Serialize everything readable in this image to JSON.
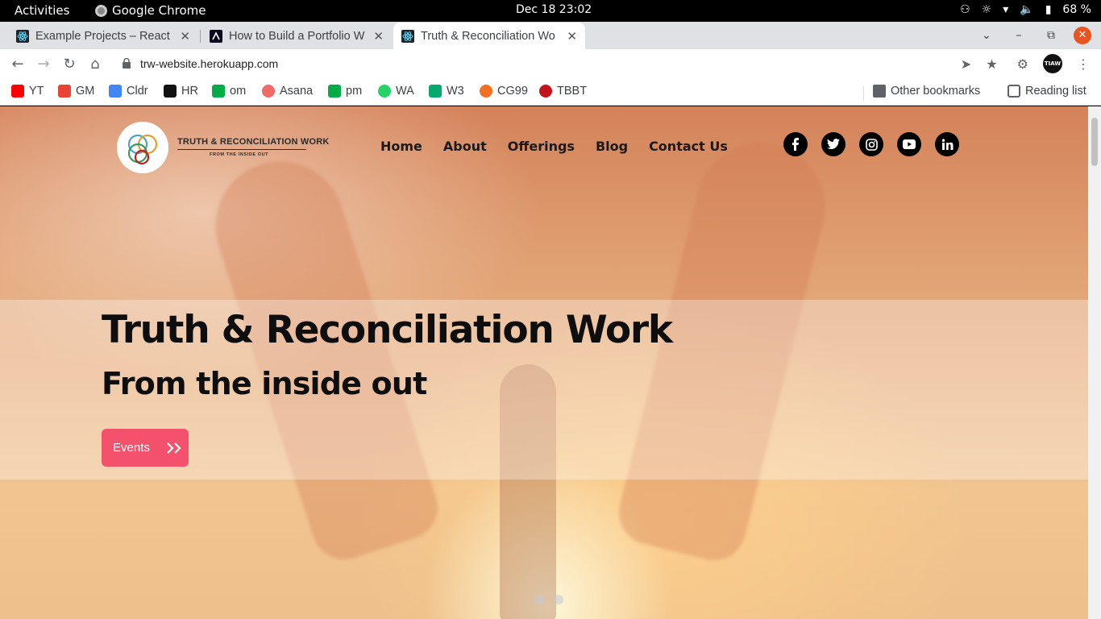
{
  "system_bar": {
    "activities": "Activities",
    "app_name": "Google Chrome",
    "clock": "Dec 18  23:02",
    "battery": "68 %"
  },
  "tabs": [
    {
      "title": "Example Projects – React",
      "active": false
    },
    {
      "title": "How to Build a Portfolio W",
      "active": false
    },
    {
      "title": "Truth & Reconciliation Wo",
      "active": true
    }
  ],
  "address_bar": {
    "url": "trw-website.herokuapp.com",
    "profile_label": "TIAW"
  },
  "bookmarks": {
    "items": [
      "YT",
      "GM",
      "Cldr",
      "HR",
      "om",
      "Asana",
      "pm",
      "WA",
      "W3",
      "CG99",
      "TBBT"
    ],
    "other": "Other bookmarks",
    "reading_list": "Reading list"
  },
  "site": {
    "logo_line1": "TRUTH & RECONCILIATION WORK",
    "logo_line2": "FROM THE INSIDE OUT",
    "nav": [
      "Home",
      "About",
      "Offerings",
      "Blog",
      "Contact Us"
    ],
    "socials": [
      "facebook-icon",
      "twitter-icon",
      "instagram-icon",
      "youtube-icon",
      "linkedin-icon"
    ],
    "hero_title": "Truth & Reconciliation Work",
    "hero_subtitle": "From the inside out",
    "cta_label": "Events",
    "accent_color": "#f4516c",
    "carousel_slides": 2
  }
}
